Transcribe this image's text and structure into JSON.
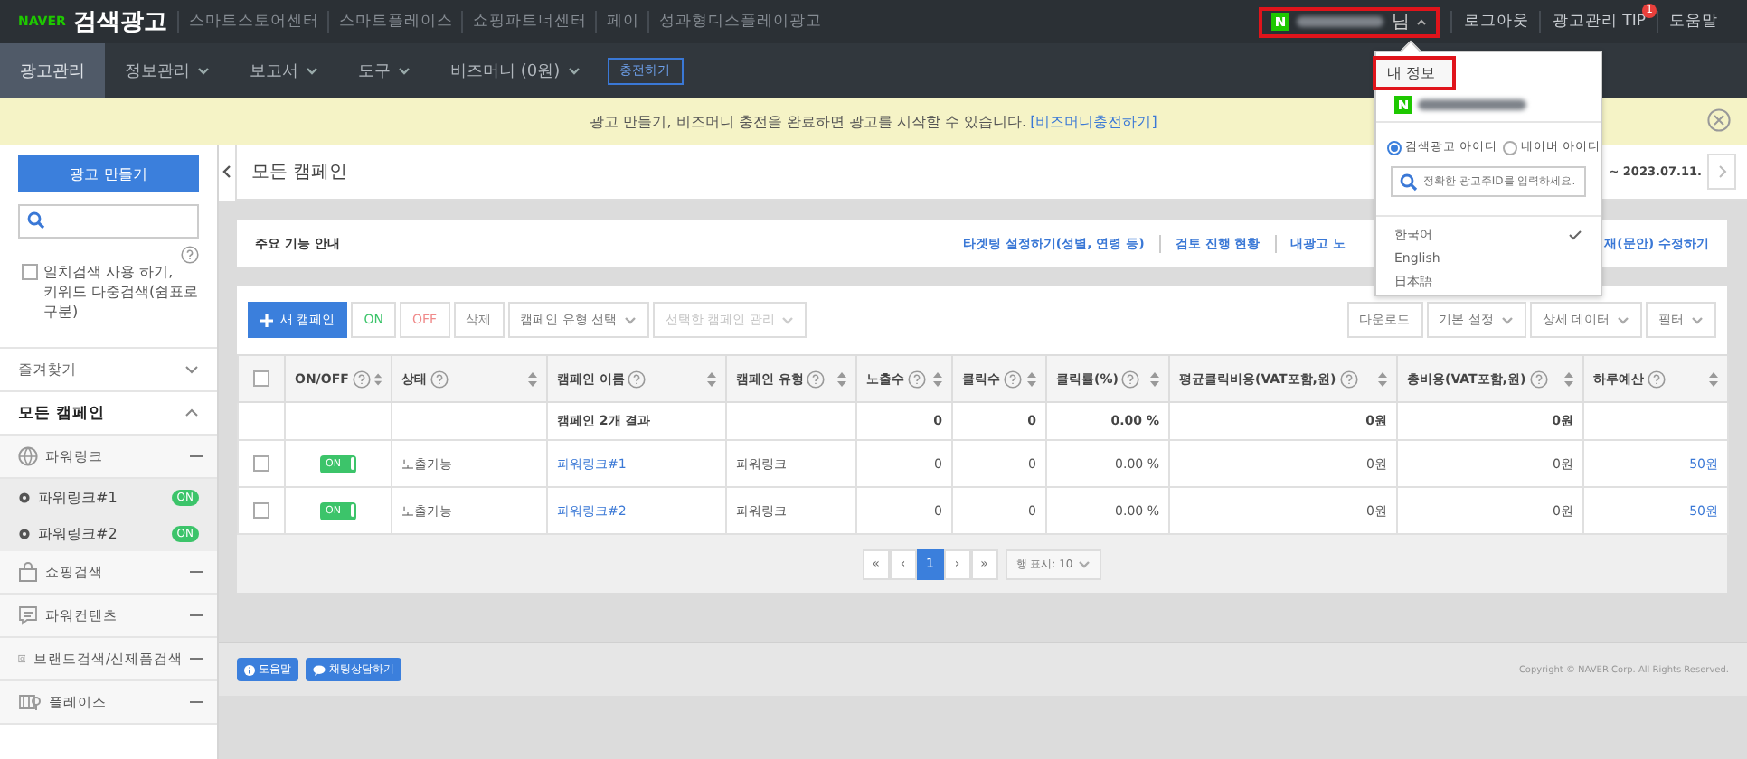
{
  "topbar": {
    "brand": "NAVER",
    "product": "검색광고",
    "links": [
      "스마트스토어센터",
      "스마트플레이스",
      "쇼핑파트너센터",
      "페이",
      "성과형디스플레이광고"
    ],
    "user_suffix": "님",
    "right_links": [
      {
        "label": "로그아웃"
      },
      {
        "label": "광고관리 TIP",
        "badge": "1"
      },
      {
        "label": "도움말"
      }
    ]
  },
  "nav": {
    "tabs": [
      {
        "label": "광고관리",
        "selected": true,
        "dropdown": false
      },
      {
        "label": "정보관리",
        "selected": false,
        "dropdown": true
      },
      {
        "label": "보고서",
        "selected": false,
        "dropdown": true
      },
      {
        "label": "도구",
        "selected": false,
        "dropdown": true
      },
      {
        "label": "비즈머니 (0원)",
        "selected": false,
        "dropdown": true
      }
    ],
    "charge_button": "충전하기"
  },
  "notice": {
    "text": "광고 만들기, 비즈머니 충전을 완료하면 광고를 시작할 수 있습니다.",
    "link": "[비즈머니충전하기]"
  },
  "sidebar": {
    "create_button": "광고 만들기",
    "exact_match": {
      "label": "일치검색 사용 하기,",
      "label_2": "키워드 다중검색(쉼표로 구분)",
      "checked": false
    },
    "sections": [
      {
        "label": "즐겨찾기",
        "expanded": false,
        "selected": false
      },
      {
        "label": "모든 캠페인",
        "expanded": true,
        "selected": true
      }
    ],
    "campaign_types": [
      {
        "label": "파워링크",
        "kind": "globe",
        "children": [
          {
            "label": "파워링크#1",
            "on": true,
            "badge": "ON"
          },
          {
            "label": "파워링크#2",
            "on": true,
            "badge": "ON"
          }
        ]
      },
      {
        "label": "쇼핑검색",
        "kind": "bag"
      },
      {
        "label": "파워컨텐츠",
        "kind": "chat"
      },
      {
        "label": "브랜드검색/신제품검색",
        "kind": "brand"
      },
      {
        "label": "플레이스",
        "kind": "map"
      }
    ]
  },
  "header": {
    "title": "모든 캠페인",
    "date_end": "~ 2023.07.11."
  },
  "features": {
    "title": "주요 기능 안내",
    "links": [
      "타겟팅 설정하기(성별, 연령 등)",
      "검토 진행 현황",
      "내광고 노",
      "재(문안) 수정하기"
    ]
  },
  "toolbar": {
    "new_button": "새 캠페인",
    "on_button": "ON",
    "off_button": "OFF",
    "delete_button": "삭제",
    "type_select": "캠페인 유형 선택",
    "manage_select": {
      "label": "선택한 캠페인 관리",
      "disabled": true
    },
    "right": [
      {
        "label": "다운로드",
        "dropdown": false
      },
      {
        "label": "기본 설정",
        "dropdown": true
      },
      {
        "label": "상세 데이터",
        "dropdown": true
      },
      {
        "label": "필터",
        "dropdown": true
      }
    ]
  },
  "table": {
    "select_all": {
      "checked": false
    },
    "columns": [
      "ON/OFF",
      "상태",
      "캠페인 이름",
      "캠페인 유형",
      "노출수",
      "클릭수",
      "클릭률(%)",
      "평균클릭비용(VAT포함,원)",
      "총비용(VAT포함,원)",
      "하루예산"
    ],
    "summary": {
      "label": "캠페인 2개 결과",
      "impressions": "0",
      "clicks": "0",
      "ctr": "0.00 %",
      "avg_cpc": "0원",
      "cost": "0원"
    },
    "rows": [
      {
        "checked": false,
        "on": true,
        "toggle": "ON",
        "status": "노출가능",
        "name": "파워링크#1",
        "type": "파워링크",
        "impressions": "0",
        "clicks": "0",
        "ctr": "0.00 %",
        "avg_cpc": "0원",
        "cost": "0원",
        "daily_budget": "50원"
      },
      {
        "checked": false,
        "on": true,
        "toggle": "ON",
        "status": "노출가능",
        "name": "파워링크#2",
        "type": "파워링크",
        "impressions": "0",
        "clicks": "0",
        "ctr": "0.00 %",
        "avg_cpc": "0원",
        "cost": "0원",
        "daily_budget": "50원"
      }
    ]
  },
  "pagination": {
    "first": "«",
    "prev": "‹",
    "pages": [
      {
        "label": "1",
        "selected": true
      }
    ],
    "next": "›",
    "last": "»",
    "rows_per_page": "행 표시: 10"
  },
  "footer": {
    "help_button": "도움말",
    "chat_button": "채팅상담하기",
    "copyright": "Copyright © NAVER Corp. All Rights Reserved."
  },
  "account_menu": {
    "my_info": "내 정보",
    "id_types": [
      {
        "label": "검색광고 아이디",
        "selected": true
      },
      {
        "label": "네이버 아이디",
        "selected": false
      }
    ],
    "search_placeholder": "정확한 광고주ID를 입력하세요.",
    "languages": [
      {
        "label": "한국어",
        "checked": true
      },
      {
        "label": "English",
        "checked": false
      },
      {
        "label": "日本語",
        "checked": false
      }
    ]
  }
}
